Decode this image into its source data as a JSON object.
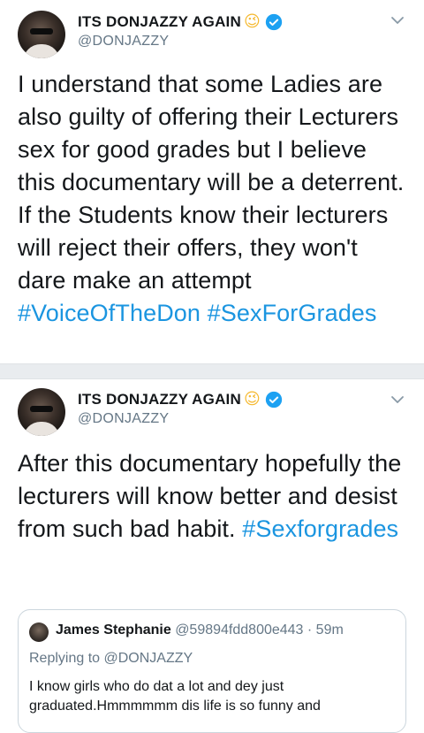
{
  "tweets": [
    {
      "display_name": "ITS DONJAZZY AGAIN",
      "emoji": "😉",
      "handle": "@DONJAZZY",
      "text": "I understand that some Ladies are also guilty of offering their Lecturers sex for good grades but I believe this documentary will be a deterrent. If the Students know their lecturers will reject their offers, they won't dare make an attempt",
      "hashtags": [
        "#VoiceOfTheDon",
        "#SexForGrades"
      ]
    },
    {
      "display_name": "ITS DONJAZZY AGAIN",
      "emoji": "😉",
      "handle": "@DONJAZZY",
      "text": "After this documentary hopefully the lecturers will know better and desist from such bad habit.",
      "hashtags": [
        "#Sexforgrades"
      ],
      "quoted": {
        "name": "James Stephanie",
        "handle": "@59894fdd800e443",
        "time": "· 59m",
        "replying_to": "Replying to @DONJAZZY",
        "text": "I know girls who do dat a lot and dey just graduated.Hmmmmmm dis life is so funny and"
      }
    }
  ],
  "colors": {
    "hashtag": "#1b95e0",
    "verified": "#1da1f2",
    "secondary_text": "#657786"
  }
}
